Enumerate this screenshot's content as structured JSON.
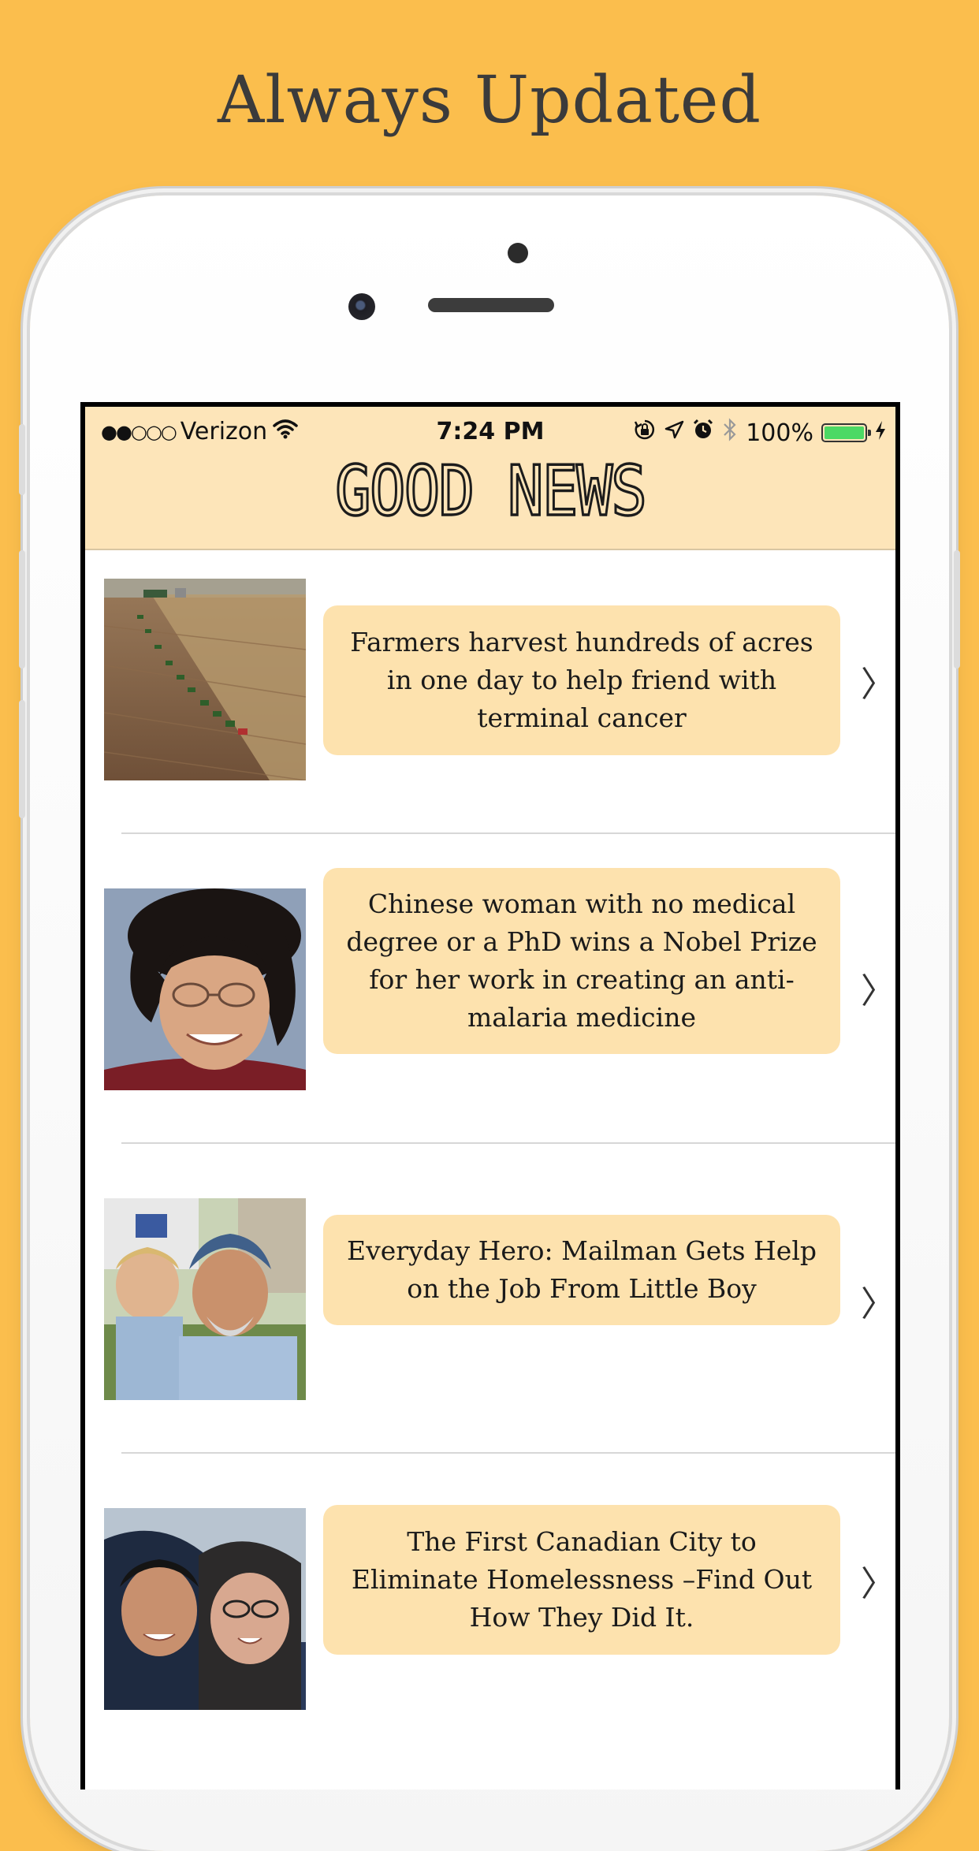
{
  "headline": "Always Updated",
  "status_bar": {
    "signal": "●●○○○",
    "carrier": "Verizon",
    "time": "7:24 PM",
    "battery": "100%"
  },
  "app": {
    "title": "GOOD NEWS"
  },
  "articles": [
    {
      "title": "Farmers harvest hundreds of acres in one day to help friend with terminal cancer"
    },
    {
      "title": "Chinese woman with no medical degree or a PhD wins a Nobel Prize for her work in creating an anti-malaria medicine"
    },
    {
      "title": "Everyday Hero: Mailman Gets Help on the Job From Little Boy"
    },
    {
      "title": "The First Canadian City to Eliminate Homelessness –Find Out How They Did It."
    }
  ],
  "colors": {
    "background": "#fbbe4d",
    "nav": "#fde5b9",
    "card": "#fde2ae"
  },
  "icons": [
    "wifi-icon",
    "orientation-lock-icon",
    "location-icon",
    "alarm-icon",
    "bluetooth-icon",
    "battery-icon",
    "charging-icon",
    "chevron-right-icon"
  ]
}
